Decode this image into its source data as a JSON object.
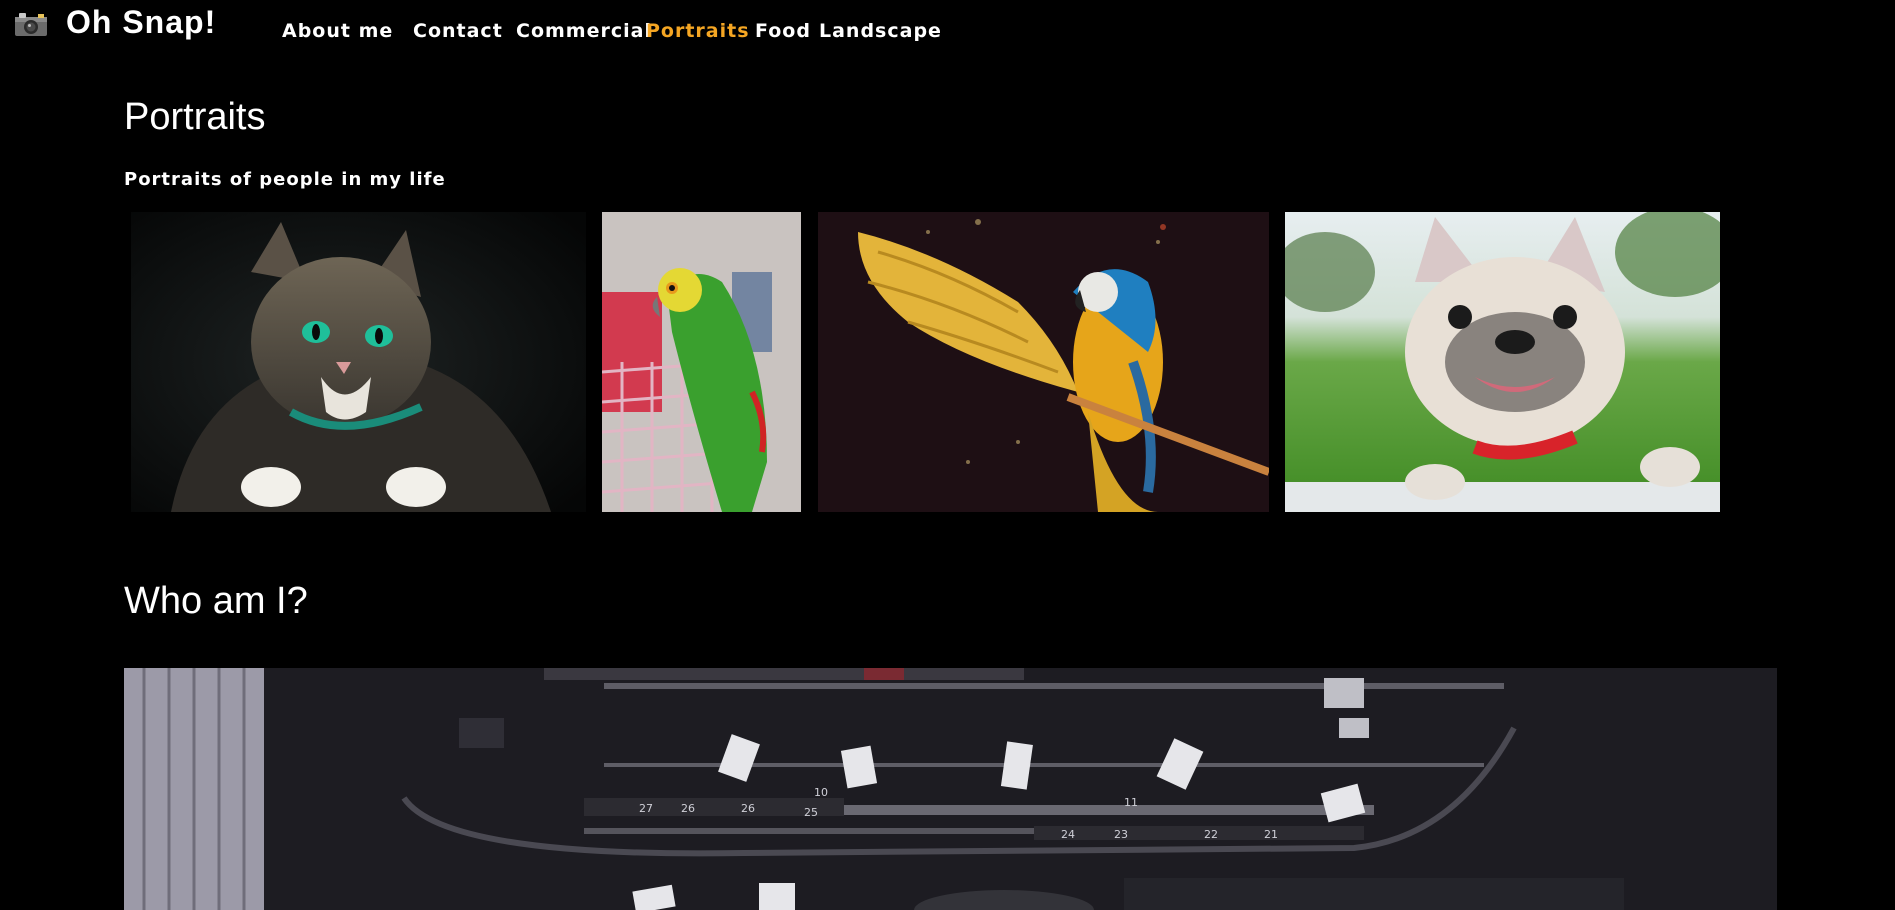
{
  "brand": {
    "title": "Oh Snap!",
    "icon": "camera-icon"
  },
  "nav": {
    "items": [
      {
        "label": "About me",
        "active": false
      },
      {
        "label": "Contact",
        "active": false
      },
      {
        "label": "Commercial",
        "active": false
      },
      {
        "label": "Portraits",
        "active": true
      },
      {
        "label": "Food",
        "active": false
      },
      {
        "label": "Landscape",
        "active": false
      }
    ],
    "active_color": "#f5a623"
  },
  "portraits": {
    "title": "Portraits",
    "subtitle": "Portraits of people in my life",
    "photos": [
      {
        "subject": "cat"
      },
      {
        "subject": "green parrot"
      },
      {
        "subject": "macaw"
      },
      {
        "subject": "french bulldog"
      }
    ]
  },
  "about": {
    "title": "Who am I?",
    "hero": {
      "subject": "stage lights"
    }
  },
  "hero_numbers": [
    "27",
    "26",
    "26",
    "25",
    "10",
    "11",
    "24",
    "23",
    "22",
    "21"
  ],
  "colors": {
    "background": "#000000",
    "text": "#ffffff",
    "accent": "#f5a623"
  }
}
